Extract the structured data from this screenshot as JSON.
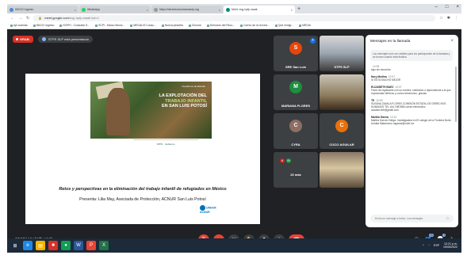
{
  "browser": {
    "tabs": [
      {
        "label": "INICIO Ingreso"
      },
      {
        "label": "WhatsApp"
      },
      {
        "label": "https://derechoshumanosslp.org"
      },
      {
        "label": "Meet: eqy-hpfp-waak"
      }
    ],
    "url_domain": "meet.google.com",
    "url_path": "/eqy-hpfp-waak?pli=1",
    "bookmarks": [
      "Apl cuentas",
      "INICIO Ingreso",
      "ISSPH - Consultar S...",
      "SCPI - Marco Munic...",
      "MEGALIS Consu...",
      "Nueva pestaña",
      "Chrome",
      "Dirección del Reco...",
      "Correo de la red est...",
      "Qué inmigr...",
      "MEDIA"
    ]
  },
  "meet": {
    "recording_label": "GRAB.",
    "presenting_label": "STPS SLP está presentando",
    "time": "12:17",
    "separator": "|",
    "meeting_code": "eqy-hpfp-waak",
    "people_count": "28",
    "chat_count": "1"
  },
  "slide": {
    "photo_subtitle": "Cuadernos de Estudio",
    "photo_title_line1": "LA EXPLOTACIÓN DEL",
    "photo_title_line2": "TRABAJO INFANTIL",
    "photo_title_line3": "EN SAN LUIS POTOSÍ",
    "logos_text": "STPS · Gobierno",
    "title": "Retos y perspectivas en la eliminación del trabajo infantil de refugiados en México",
    "presenter": "Presenta: Lilia May, Asociada de Protección, ACNUR San Luis Potosí",
    "unhcr": "UNHCR ACNUR"
  },
  "participants": [
    {
      "name": "SRE San Luis",
      "initial": "S",
      "color": "#e8450a",
      "pinned": true
    },
    {
      "name": "STPS SLP",
      "initial": "",
      "video": true
    },
    {
      "name": "MARIANA FLORES",
      "initial": "M",
      "color": "#1e8e3e"
    },
    {
      "name": "",
      "initial": "",
      "video": true
    },
    {
      "name": "CYRA",
      "initial": "C",
      "color": "#8d6e63"
    },
    {
      "name": "COCO AGUILAR",
      "initial": "C",
      "color": "#e8710a"
    },
    {
      "name": "23 más",
      "initial": "",
      "color": ""
    },
    {
      "name": "",
      "initial": "",
      "video": true
    }
  ],
  "overflow_initials": [
    "A",
    "M"
  ],
  "chat": {
    "title": "Mensajes en la llamada",
    "note": "Los mensajes solo son visibles para los participantes de la llamada y se borran cuando ésta finaliza.",
    "messages": [
      {
        "author": "",
        "time": "12:05",
        "text": "sigo sin escuchar"
      },
      {
        "author": "Nory Medina",
        "time": "12:07",
        "text": "SI ESTÁ MUCHO MEJOR"
      },
      {
        "author": "ELIZABETH BAEZ",
        "time": "12:07",
        "text": "Favor de registrarse con su nombre, institución o dependencia a la que representan teléfono y correo electrónico. gracias"
      },
      {
        "author": "TE",
        "time": "12:09",
        "text": "SUSANA ZAVALA FLORES COMISIÓN ESTATAL DE DERECHOS HUMANOS TEL 444 1987685 correo electrónico szavala.edh@gmail.com"
      },
      {
        "author": "Martha García",
        "time": "12:12",
        "text": "Martha García Ortega- Investigadora en El colegio de la Frontera Norte. Unidad Matamoros mgarcia@colef.mx"
      }
    ],
    "input_placeholder": "Envía un mensaje a todos. Los mensajes",
    "send_icon": "▷"
  },
  "taskbar": {
    "clock_time": "12:21 p.m.",
    "clock_date": "19/05/2022",
    "lang": "ESP"
  }
}
